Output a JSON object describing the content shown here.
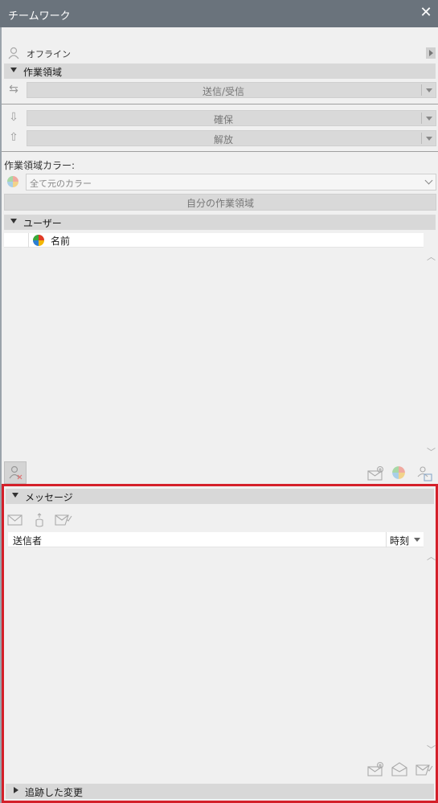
{
  "window": {
    "title": "チームワーク"
  },
  "status": {
    "label": "オフライン"
  },
  "workspace": {
    "header": "作業領域",
    "send_receive": "送信/受信",
    "reserve": "確保",
    "release": "解放",
    "color_label": "作業領域カラー:",
    "color_select": "全て元のカラー",
    "my_workspace_button": "自分の作業領域"
  },
  "users": {
    "header": "ユーザー",
    "column_name": "名前"
  },
  "messages": {
    "header": "メッセージ",
    "column_sender": "送信者",
    "column_time": "時刻"
  },
  "tracked": {
    "header": "追跡した変更"
  },
  "colors": {
    "titlebar": "#6a737c",
    "panel": "#f0f0f0",
    "highlight": "#d4202a"
  }
}
